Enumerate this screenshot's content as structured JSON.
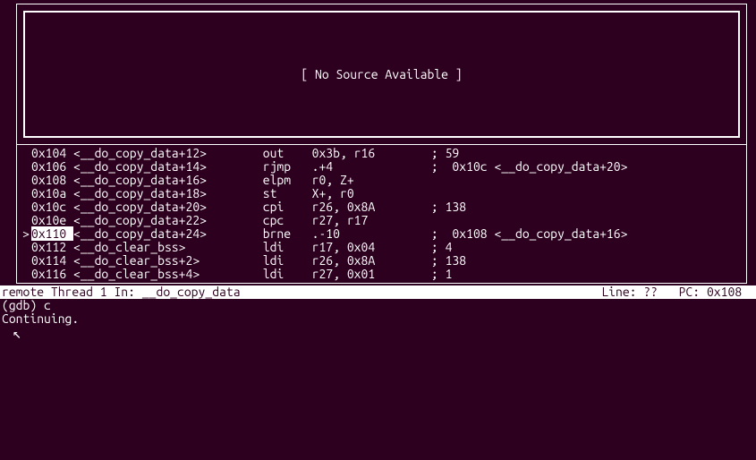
{
  "source_panel": {
    "message": "[ No Source Available ]"
  },
  "disassembly": {
    "current_index": 6,
    "rows": [
      {
        "gutter": " ",
        "addr": "0x104 ",
        "sym": "<__do_copy_data+12>",
        "mnem": "out",
        "ops": "0x3b, r16",
        "comment": "; 59"
      },
      {
        "gutter": " ",
        "addr": "0x106 ",
        "sym": "<__do_copy_data+14>",
        "mnem": "rjmp",
        "ops": ".+4",
        "comment": ";  0x10c <__do_copy_data+20>"
      },
      {
        "gutter": " ",
        "addr": "0x108 ",
        "sym": "<__do_copy_data+16>",
        "mnem": "elpm",
        "ops": "r0, Z+",
        "comment": ""
      },
      {
        "gutter": " ",
        "addr": "0x10a ",
        "sym": "<__do_copy_data+18>",
        "mnem": "st",
        "ops": "X+, r0",
        "comment": ""
      },
      {
        "gutter": " ",
        "addr": "0x10c ",
        "sym": "<__do_copy_data+20>",
        "mnem": "cpi",
        "ops": "r26, 0x8A",
        "comment": "; 138"
      },
      {
        "gutter": " ",
        "addr": "0x10e ",
        "sym": "<__do_copy_data+22>",
        "mnem": "cpc",
        "ops": "r27, r17",
        "comment": ""
      },
      {
        "gutter": ">",
        "addr": "0x110 ",
        "sym": "<__do_copy_data+24>",
        "mnem": "brne",
        "ops": ".-10",
        "comment": ";  0x108 <__do_copy_data+16>"
      },
      {
        "gutter": " ",
        "addr": "0x112 ",
        "sym": "<__do_clear_bss>",
        "mnem": "ldi",
        "ops": "r17, 0x04",
        "comment": "; 4"
      },
      {
        "gutter": " ",
        "addr": "0x114 ",
        "sym": "<__do_clear_bss+2>",
        "mnem": "ldi",
        "ops": "r26, 0x8A",
        "comment": "; 138"
      },
      {
        "gutter": " ",
        "addr": "0x116 ",
        "sym": "<__do_clear_bss+4>",
        "mnem": "ldi",
        "ops": "r27, 0x01",
        "comment": "; 1"
      }
    ]
  },
  "status": {
    "left": "remote Thread 1 In: __do_copy_data",
    "right_line_label": "Line:",
    "right_line_value": "??",
    "right_pc_label": "PC:",
    "right_pc_value": "0x108"
  },
  "console": {
    "prompt": "(gdb) ",
    "command": "c",
    "output": "Continuing.",
    "cursor_glyph": "↖"
  }
}
